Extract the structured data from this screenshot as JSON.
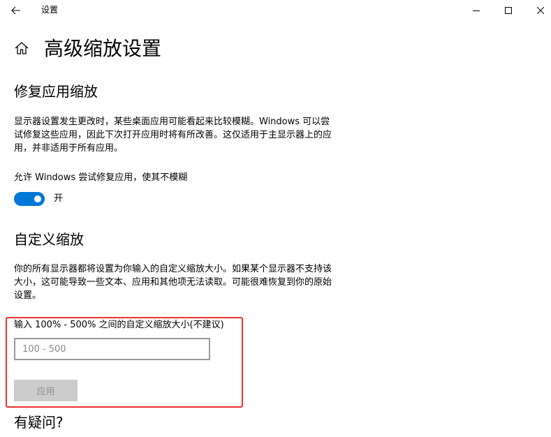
{
  "titlebar": {
    "app_title": "设置",
    "back_icon": "back-arrow-icon",
    "minimize_icon": "minimize-icon",
    "maximize_icon": "maximize-icon",
    "close_icon": "close-icon"
  },
  "header": {
    "home_icon": "home-icon",
    "page_title": "高级缩放设置"
  },
  "fix_scaling": {
    "title": "修复应用缩放",
    "description": "显示器设置发生更改时，某些桌面应用可能看起来比较模糊。Windows 可以尝试修复这些应用，因此下次打开应用时将有所改善。这仅适用于主显示器上的应用，并非适用于所有应用。",
    "toggle_label": "允许 Windows 尝试修复应用，使其不模糊",
    "toggle_state": "开",
    "toggle_on": true,
    "accent_color": "#0078d7"
  },
  "custom_scaling": {
    "title": "自定义缩放",
    "description": "你的所有显示器都将设置为你输入的自定义缩放大小。如果某个显示器不支持该大小，这可能导致一些文本、应用和其他项无法读取。可能很难恢复到你的原始设置。",
    "input_label": "输入 100% - 500% 之间的自定义缩放大小(不建议)",
    "input_value": "",
    "input_placeholder": "100 - 500",
    "apply_label": "应用",
    "highlight_color": "#e8312f"
  },
  "help": {
    "title": "有疑问?"
  }
}
